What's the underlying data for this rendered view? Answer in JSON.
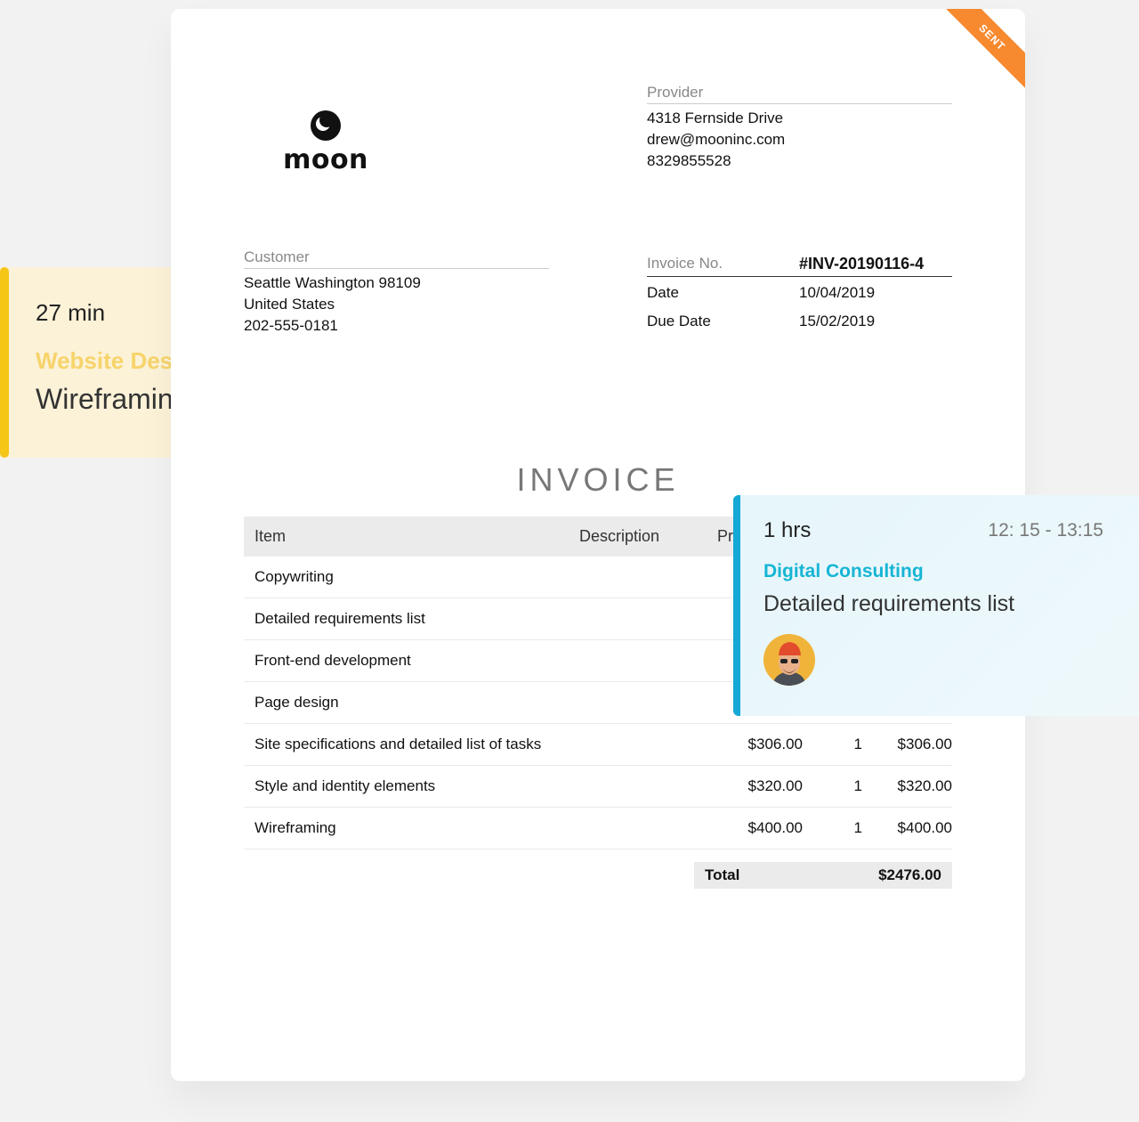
{
  "time_card_left": {
    "duration": "27 min",
    "project": "Website Des",
    "task": "Wireframin",
    "accent_color": "#f5c518"
  },
  "invoice": {
    "status_ribbon": "SENT",
    "logo_text": "moon",
    "provider": {
      "label": "Provider",
      "address": "4318 Fernside Drive",
      "email": "drew@mooninc.com",
      "phone": "8329855528"
    },
    "customer": {
      "label": "Customer",
      "address": "Seattle Washington 98109",
      "country": "United States",
      "phone": "202-555-0181"
    },
    "meta": {
      "invoice_no_label": "Invoice No.",
      "invoice_no": "#INV-20190116-4",
      "date_label": "Date",
      "date": "10/04/2019",
      "due_label": "Due Date",
      "due_date": "15/02/2019"
    },
    "title": "INVOICE",
    "table": {
      "headers": {
        "item": "Item",
        "description": "Description",
        "price": "Pr"
      },
      "rows": [
        {
          "item": "Copywriting",
          "price": "",
          "qty": "",
          "amount": ""
        },
        {
          "item": "Detailed requirements list",
          "price": "",
          "qty": "",
          "amount": ""
        },
        {
          "item": "Front-end development",
          "price": "",
          "qty": "",
          "amount": ""
        },
        {
          "item": "Page design",
          "price": "",
          "qty": "",
          "amount": ""
        },
        {
          "item": "Site specifications and detailed list of  tasks",
          "price": "$306.00",
          "qty": "1",
          "amount": "$306.00"
        },
        {
          "item": "Style and identity elements",
          "price": "$320.00",
          "qty": "1",
          "amount": "$320.00"
        },
        {
          "item": "Wireframing",
          "price": "$400.00",
          "qty": "1",
          "amount": "$400.00"
        }
      ]
    },
    "total_label": "Total",
    "total_value": "$2476.00"
  },
  "time_card_right": {
    "duration": "1 hrs",
    "time_range": "12: 15 - 13:15",
    "project": "Digital Consulting",
    "task": "Detailed requirements list",
    "accent_color": "#14a8d6"
  }
}
